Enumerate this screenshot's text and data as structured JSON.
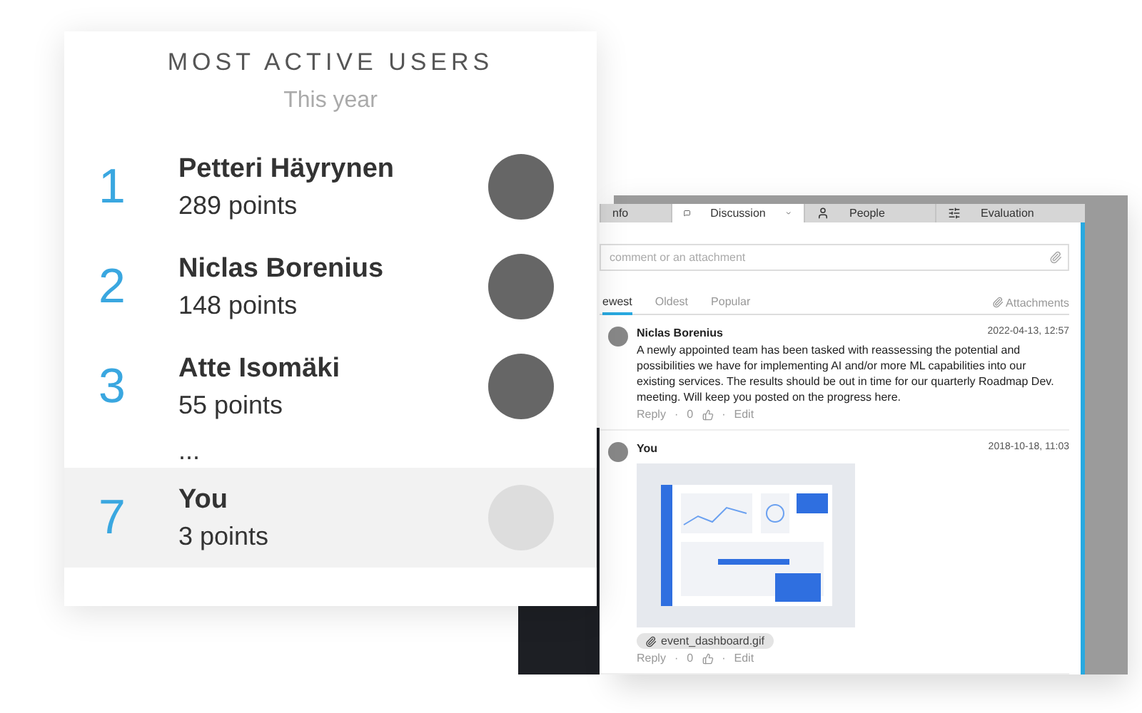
{
  "leaderboard": {
    "title": "MOST ACTIVE USERS",
    "period": "This year",
    "users": [
      {
        "rank": "1",
        "name": "Petteri Häyrynen",
        "points": "289 points",
        "selected": false
      },
      {
        "rank": "2",
        "name": "Niclas Borenius",
        "points": "148 points",
        "selected": false
      },
      {
        "rank": "3",
        "name": "Atte Isomäki",
        "points": "55 points",
        "selected": false
      },
      {
        "kind": "gap",
        "text": "..."
      },
      {
        "rank": "7",
        "name": "You",
        "points": "3 points",
        "selected": true
      }
    ]
  },
  "discussion": {
    "tabs": [
      {
        "label": "nfo",
        "kind": "plain",
        "selected": false
      },
      {
        "label": "Discussion",
        "kind": "chat",
        "selected": true
      },
      {
        "label": "People",
        "kind": "person",
        "selected": false
      },
      {
        "label": "Evaluation",
        "kind": "sliders",
        "selected": false
      }
    ],
    "comment_field": {
      "placeholder": "comment or an attachment"
    },
    "sort_tabs": [
      {
        "label": "ewest",
        "selected": true
      },
      {
        "label": "Oldest",
        "selected": false
      },
      {
        "label": "Popular",
        "selected": false
      }
    ],
    "attachments_link": "Attachments",
    "comments": [
      {
        "author": "Niclas Borenius",
        "time": "2022-04-13, 12:57",
        "text": "A newly appointed team has been tasked with reassessing the potential and possibilities we have for implementing AI and/or more ML capabilities into our existing services. The results should be out in time for our quarterly Roadmap Dev. meeting. Will keep you posted on the progress here.",
        "reply": "Reply",
        "separator_1": "·",
        "likes": "0",
        "separator_2": "·",
        "edit": "Edit"
      },
      {
        "author": "You",
        "time": "2018-10-18, 11:03",
        "reply": "Reply",
        "separator_1": "·",
        "likes": "0",
        "separator_2": "·",
        "edit": "Edit",
        "attachment": "event_dashboard.gif"
      }
    ]
  }
}
